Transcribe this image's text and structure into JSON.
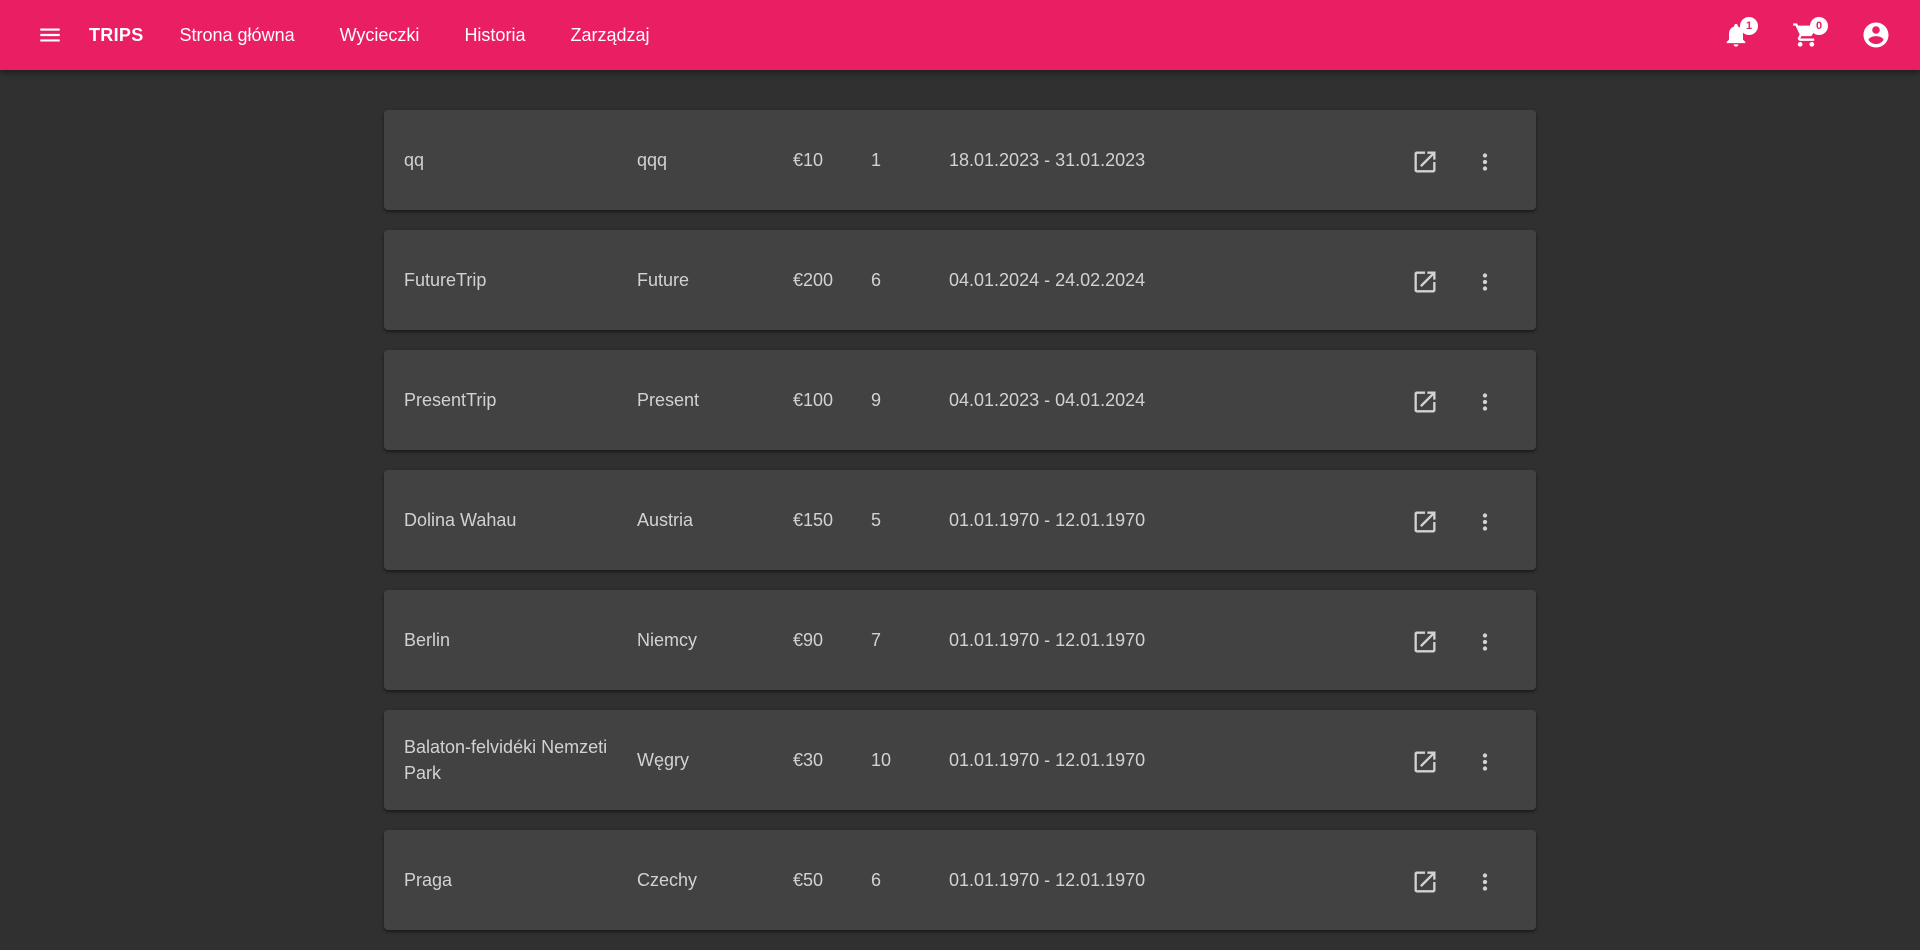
{
  "app": {
    "brand": "TRIPS",
    "nav": [
      {
        "label": "Strona główna"
      },
      {
        "label": "Wycieczki"
      },
      {
        "label": "Historia"
      },
      {
        "label": "Zarządzaj"
      }
    ],
    "notifications_count": "1",
    "cart_count": "0",
    "icons": {
      "menu": "menu-icon",
      "notifications": "bell-icon",
      "cart": "cart-icon",
      "account": "account-circle-icon",
      "open": "open-in-new-icon",
      "more": "more-vert-icon"
    },
    "colors": {
      "toolbar": "#e91e63",
      "background": "#303030",
      "card": "#424242",
      "text": "#d2d2d2"
    }
  },
  "trips": [
    {
      "name": "qq",
      "country": "qqq",
      "price": "€10",
      "qty": "1",
      "dates": "18.01.2023 - 31.01.2023"
    },
    {
      "name": "FutureTrip",
      "country": "Future",
      "price": "€200",
      "qty": "6",
      "dates": "04.01.2024 - 24.02.2024"
    },
    {
      "name": "PresentTrip",
      "country": "Present",
      "price": "€100",
      "qty": "9",
      "dates": "04.01.2023 - 04.01.2024"
    },
    {
      "name": "Dolina Wahau",
      "country": "Austria",
      "price": "€150",
      "qty": "5",
      "dates": "01.01.1970 - 12.01.1970"
    },
    {
      "name": "Berlin",
      "country": "Niemcy",
      "price": "€90",
      "qty": "7",
      "dates": "01.01.1970 - 12.01.1970"
    },
    {
      "name": "Balaton-felvidéki Nemzeti Park",
      "country": "Węgry",
      "price": "€30",
      "qty": "10",
      "dates": "01.01.1970 - 12.01.1970"
    },
    {
      "name": "Praga",
      "country": "Czechy",
      "price": "€50",
      "qty": "6",
      "dates": "01.01.1970 - 12.01.1970"
    }
  ]
}
